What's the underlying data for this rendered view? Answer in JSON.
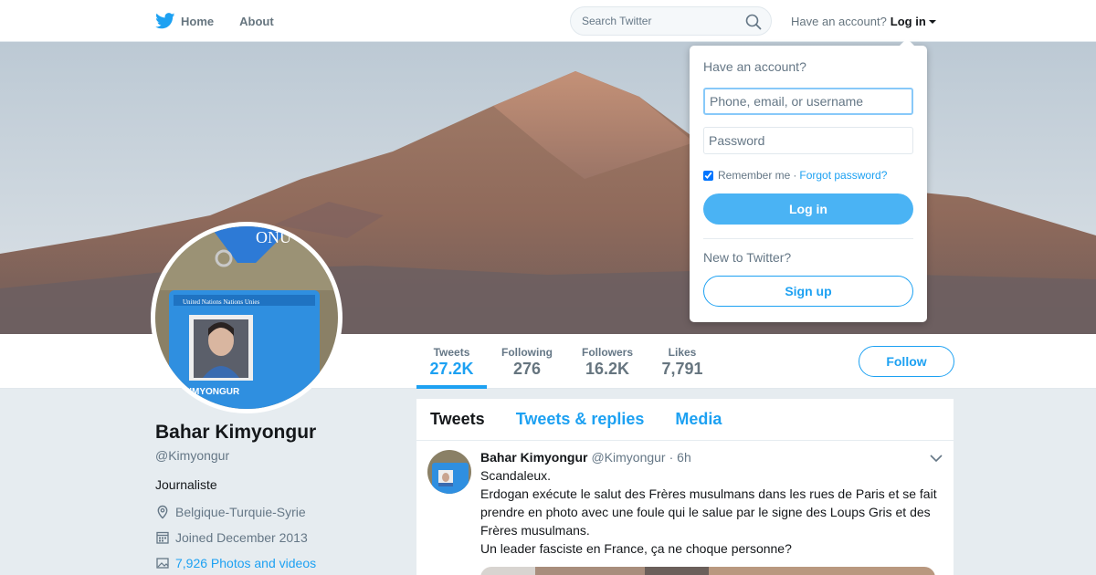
{
  "nav": {
    "home_label": "Home",
    "about_label": "About",
    "search_placeholder": "Search Twitter",
    "have_account": "Have an account?",
    "login_label": "Log in",
    "icons": {
      "logo": "twitter-bird-icon",
      "search": "search-icon",
      "caret": "caret-down-icon"
    }
  },
  "stats": [
    {
      "label": "Tweets",
      "value": "27.2K"
    },
    {
      "label": "Following",
      "value": "276"
    },
    {
      "label": "Followers",
      "value": "16.2K"
    },
    {
      "label": "Likes",
      "value": "7,791"
    }
  ],
  "follow_label": "Follow",
  "profile": {
    "name": "Bahar Kimyongur",
    "handle": "@Kimyongur",
    "bio": "Journaliste",
    "location": "Belgique-Turquie-Syrie",
    "joined": "Joined December 2013",
    "photos": "7,926 Photos and videos",
    "badge_text": "ONU",
    "card_text": "United Nations  Nations Unies",
    "card_name": "KIMYONGUR"
  },
  "timeline": {
    "tabs": [
      "Tweets",
      "Tweets & replies",
      "Media"
    ],
    "tweet": {
      "name": "Bahar Kimyongur",
      "handle": "@Kimyongur",
      "time": "· 6h",
      "lines": [
        "Scandaleux.",
        "Erdogan exécute le salut des Frères musulmans dans les rues de Paris et se fait prendre en photo avec une foule qui le salue par le signe des Loups Gris et des Frères musulmans.",
        "Un leader fasciste en France, ça ne choque personne?"
      ]
    }
  },
  "login_dropdown": {
    "title": "Have an account?",
    "username_placeholder": "Phone, email, or username",
    "password_placeholder": "Password",
    "remember_label": "Remember me",
    "separator": "·",
    "forgot_label": "Forgot password?",
    "login_button": "Log in",
    "new_label": "New to Twitter?",
    "signup_button": "Sign up"
  },
  "colors": {
    "accent": "#1da1f2",
    "background": "#e6ecf0",
    "login_button": "#4ab3f4"
  }
}
